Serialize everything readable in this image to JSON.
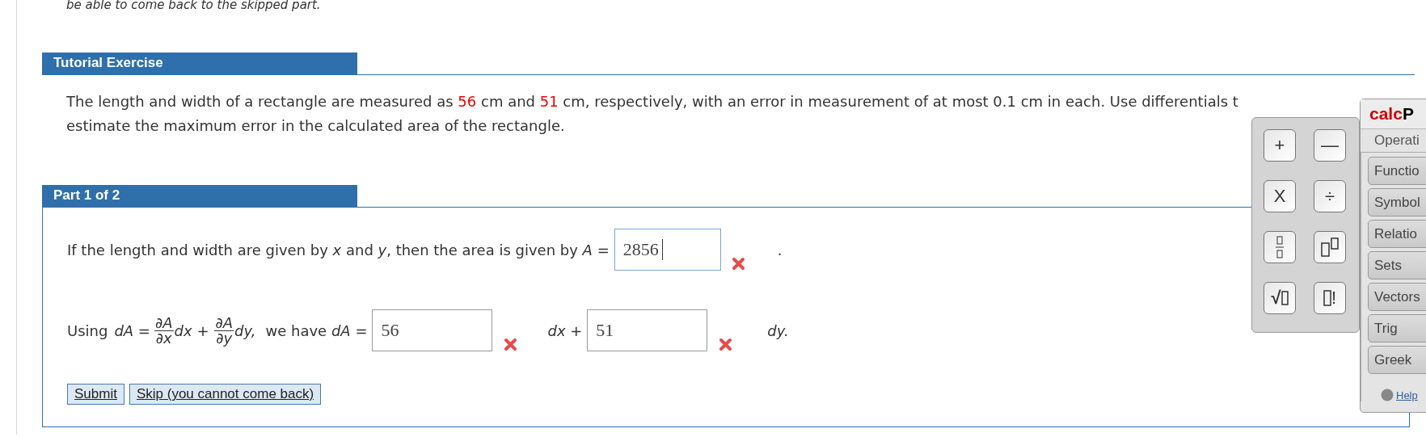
{
  "intro": "be able to come back to the skipped part.",
  "tutorial": {
    "title": "Tutorial Exercise",
    "problem": [
      {
        "kind": "plain",
        "text": "The length and width of a rectangle are measured as "
      },
      {
        "kind": "value",
        "text": "56"
      },
      {
        "kind": "plain",
        "text": " cm and "
      },
      {
        "kind": "value",
        "text": "51"
      },
      {
        "kind": "plain",
        "text": " cm, respectively, with an error in measurement of at most 0.1 cm in each. Use differentials t"
      }
    ],
    "problem_line_2": "estimate the maximum error in the calculated area of the rectangle."
  },
  "part": {
    "title": "Part 1 of 2",
    "line_1": {
      "text": "If the length and width are given by *x* and *y*, then the area is given by *A* =",
      "answer": {
        "value": "2856",
        "focused": true,
        "correct": false
      },
      "end": "."
    },
    "line_2": {
      "using": "Using",
      "lhs": "*dA* =",
      "terms": [
        {
          "numerator": "∂A",
          "denominator": "∂x",
          "differential": "dx +"
        },
        {
          "numerator": "∂A",
          "denominator": "∂y",
          "differential": "dy,"
        }
      ],
      "we_have": "we have *dA* =",
      "answers": [
        {
          "value": "56",
          "focused": false,
          "correct": false,
          "after": "dx +"
        },
        {
          "value": "51",
          "focused": false,
          "correct": false,
          "after": "dy."
        }
      ]
    },
    "buttons": [
      "Submit",
      "Skip (you cannot come back)"
    ]
  },
  "calcpad": {
    "title_red": "calc",
    "title_rest": "P",
    "keys": [
      {
        "kind": "plus",
        "label": "+"
      },
      {
        "kind": "minus",
        "label": "—"
      },
      {
        "kind": "times",
        "label": "X"
      },
      {
        "kind": "divide",
        "label": "÷"
      },
      {
        "kind": "fraction"
      },
      {
        "kind": "power"
      },
      {
        "kind": "sqrt",
        "label": "√"
      },
      {
        "kind": "factorial",
        "label": "!"
      }
    ],
    "operations": "Operati",
    "categories": [
      "Functio",
      "Symbol",
      "Relatio",
      "Sets",
      "Vectors",
      "Trig",
      "Greek"
    ],
    "help": "Help"
  }
}
